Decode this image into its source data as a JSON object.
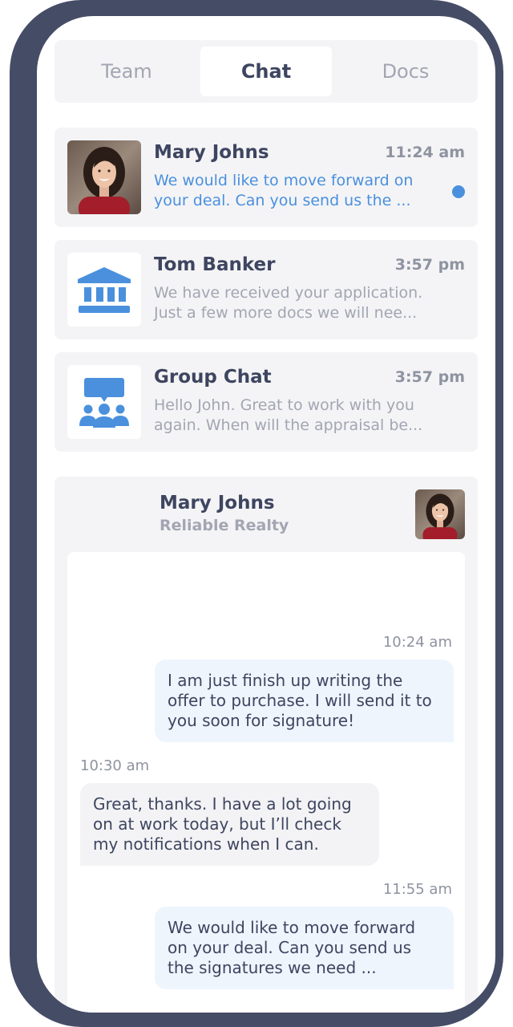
{
  "tabs": {
    "team": "Team",
    "chat": "Chat",
    "docs": "Docs"
  },
  "conversations": [
    {
      "name": "Mary Johns",
      "time": "11:24 am",
      "preview": [
        "We would like to move forward on",
        "your deal. Can you send us the ..."
      ],
      "unread": true,
      "thumb_icon": "mary-johns-photo"
    },
    {
      "name": "Tom Banker",
      "time": "3:57 pm",
      "preview": [
        "We have received your application.",
        "Just a few more docs we will nee..."
      ],
      "unread": false,
      "thumb_icon": "bank-icon"
    },
    {
      "name": "Group Chat",
      "time": "3:57 pm",
      "preview": [
        "Hello John. Great to work with you",
        "again. When will the appraisal be..."
      ],
      "unread": false,
      "thumb_icon": "group-chat-icon"
    }
  ],
  "chat_panel": {
    "name": "Mary Johns",
    "company": "Reliable Realty",
    "messages": [
      {
        "direction": "out",
        "time": "10:24 am",
        "lines": [
          "I am just finish up writing the",
          "offer to purchase. I will send it to",
          "you soon for signature!"
        ]
      },
      {
        "direction": "in",
        "time": "10:30 am",
        "lines": [
          "Great, thanks. I have a lot going",
          "on at work today, but I’ll check",
          "my notifications when I can."
        ]
      },
      {
        "direction": "out",
        "time": "11:55 am",
        "lines": [
          "We would like to move forward",
          "on your deal. Can you send us",
          "the signatures we need ..."
        ]
      }
    ]
  },
  "colors": {
    "frame": "#454c66",
    "accent": "#4a90dd",
    "card": "#f4f4f6",
    "text": "#3e4560",
    "muted": "#a2a6b2"
  }
}
